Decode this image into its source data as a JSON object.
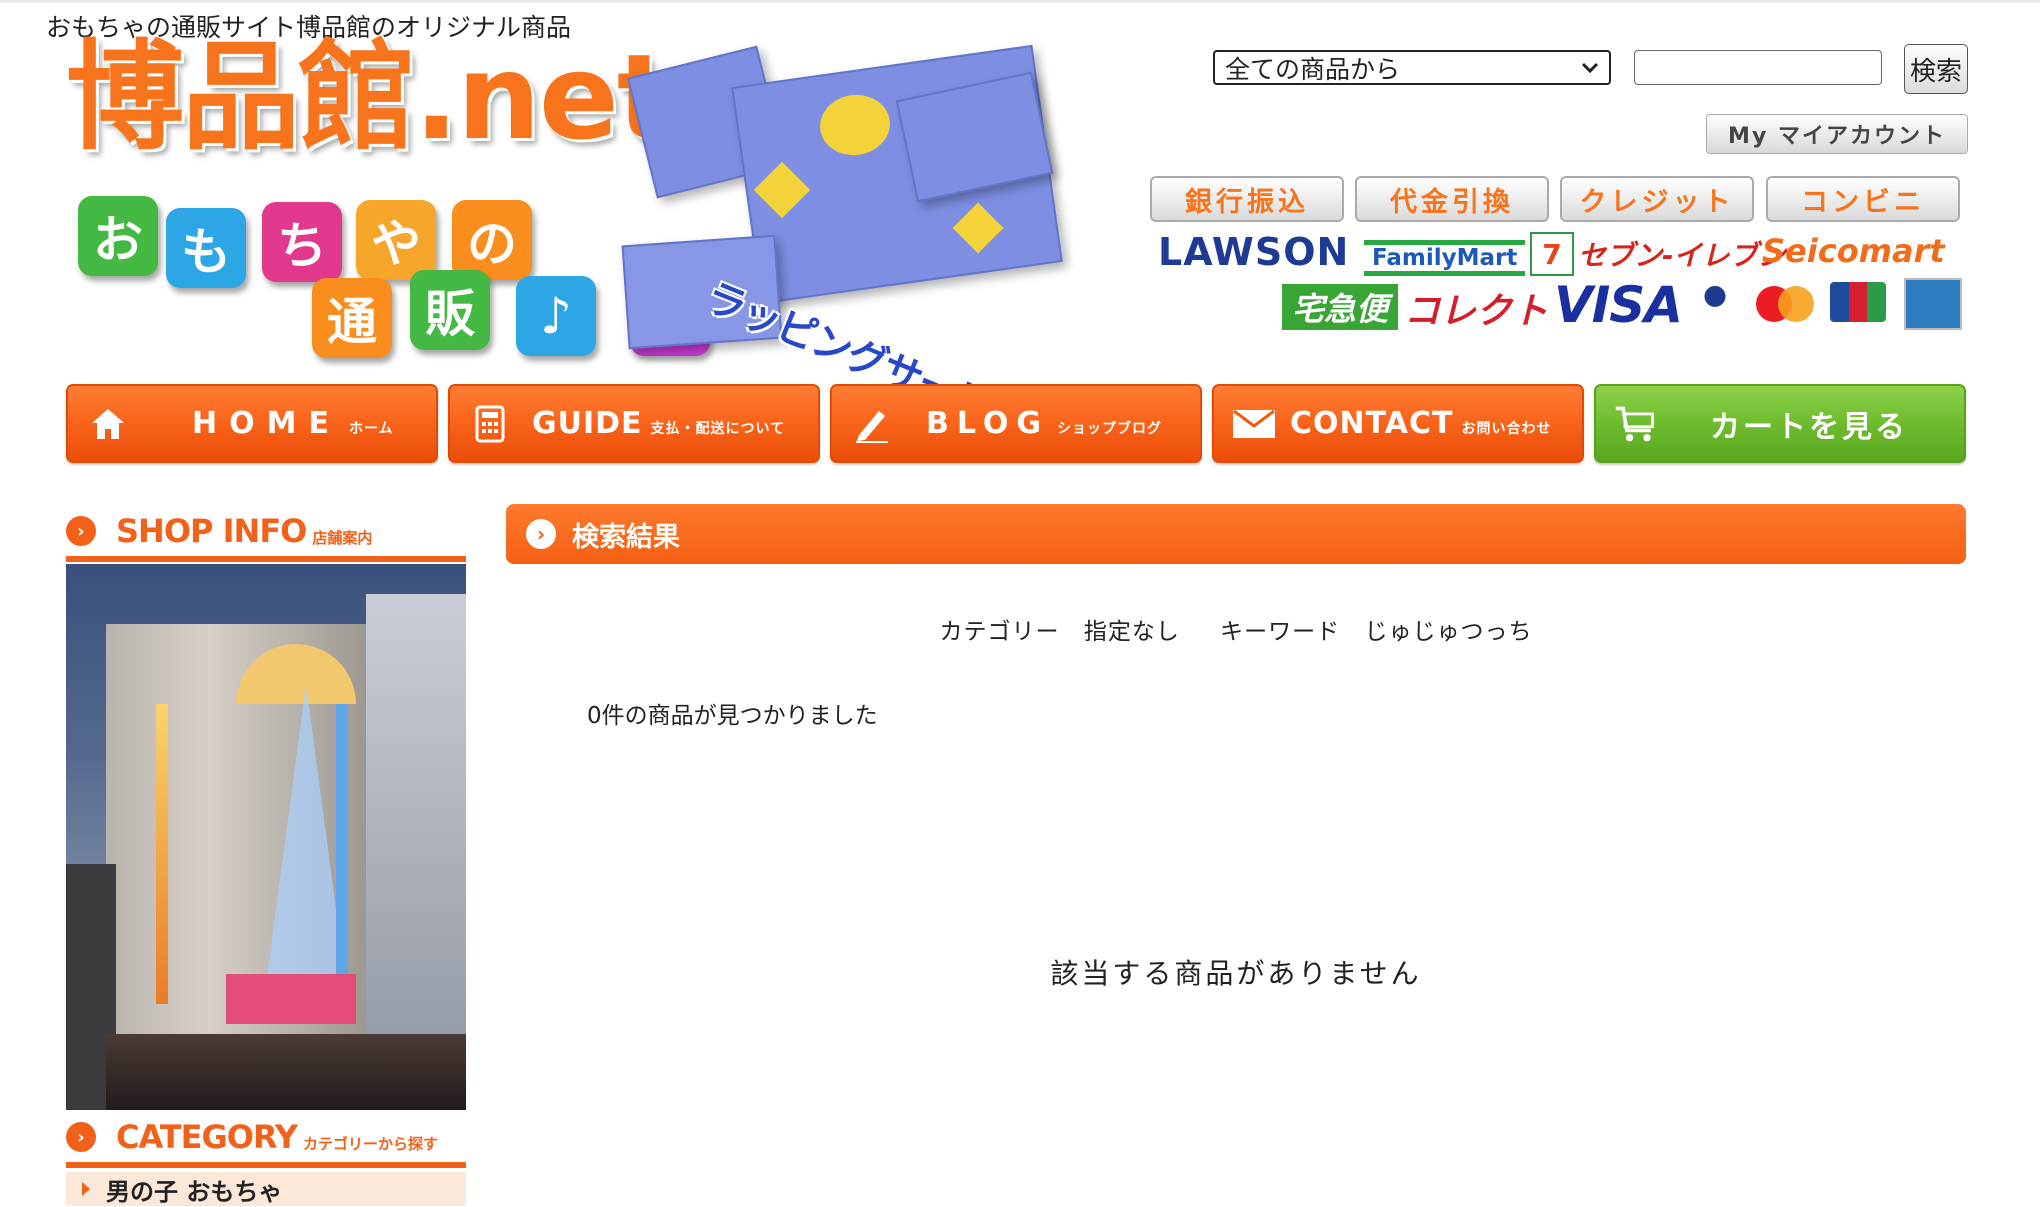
{
  "header": {
    "tagline": "おもちゃの通販サイト博品館のオリジナル商品",
    "logo_text": "博品館.net",
    "logo_tiles": [
      "お",
      "も",
      "ち",
      "や",
      "の",
      "通",
      "販",
      "♪",
      "♪"
    ],
    "wrapping_label": "ラッピングサービス"
  },
  "search": {
    "scope_selected": "全ての商品から",
    "keyword_value": "",
    "button_label": "検索"
  },
  "account": {
    "label": "My マイアカウント"
  },
  "payment": {
    "methods": [
      "銀行振込",
      "代金引換",
      "クレジット",
      "コンビニ"
    ],
    "brands_row1": [
      "LAWSON",
      "FamilyMart",
      "セブン-イレブン",
      "Seicomart"
    ],
    "brands_row2": [
      "宅急便",
      "コレクト",
      "VISA"
    ]
  },
  "nav": [
    {
      "label": "HOME",
      "sub": "ホーム",
      "icon": "home-icon"
    },
    {
      "label": "GUIDE",
      "sub": "支払・配送について",
      "icon": "calculator-icon"
    },
    {
      "label": "BLOG",
      "sub": "ショップブログ",
      "icon": "pencil-icon"
    },
    {
      "label": "CONTACT",
      "sub": "お問い合わせ",
      "icon": "mail-icon"
    },
    {
      "label": "カートを見る",
      "sub": "",
      "icon": "cart-icon"
    }
  ],
  "sidebar": {
    "shop_info_title": "SHOP INFO",
    "shop_info_sub": "店舗案内",
    "category_title": "CATEGORY",
    "category_sub": "カテゴリーから探す",
    "categories": [
      "男の子 おもちゃ"
    ]
  },
  "main": {
    "result_title": "検索結果",
    "category_label": "カテゴリー",
    "category_value": "指定なし",
    "keyword_label": "キーワード",
    "keyword_value": "じゅじゅつっち",
    "count_text": "0件の商品が見つかりました",
    "no_result_text": "該当する商品がありません"
  },
  "colors": {
    "brand_orange": "#f7741c",
    "nav_orange": "#f9631a",
    "nav_green": "#6ebc2e"
  }
}
